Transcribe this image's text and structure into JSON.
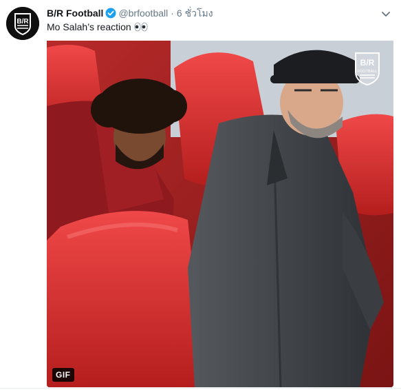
{
  "tweet": {
    "author_name": "B/R Football",
    "author_handle": "@brfootball",
    "separator": "·",
    "time": "6 ชั่วโมง",
    "text": "Mo Salah’s reaction",
    "emoji": "eyes-emoji",
    "verified_icon": "verified-badge-icon",
    "menu_icon": "chevron-down-icon",
    "avatar_logo": "B/R",
    "media": {
      "badge": "GIF",
      "watermark_logo": "B/R",
      "watermark_sub": "FOOTBALL"
    }
  },
  "colors": {
    "name": "#14171a",
    "meta": "#657786",
    "verified": "#1da1f2",
    "seat_red": "#d42a2a",
    "jacket": "#3d4145"
  }
}
